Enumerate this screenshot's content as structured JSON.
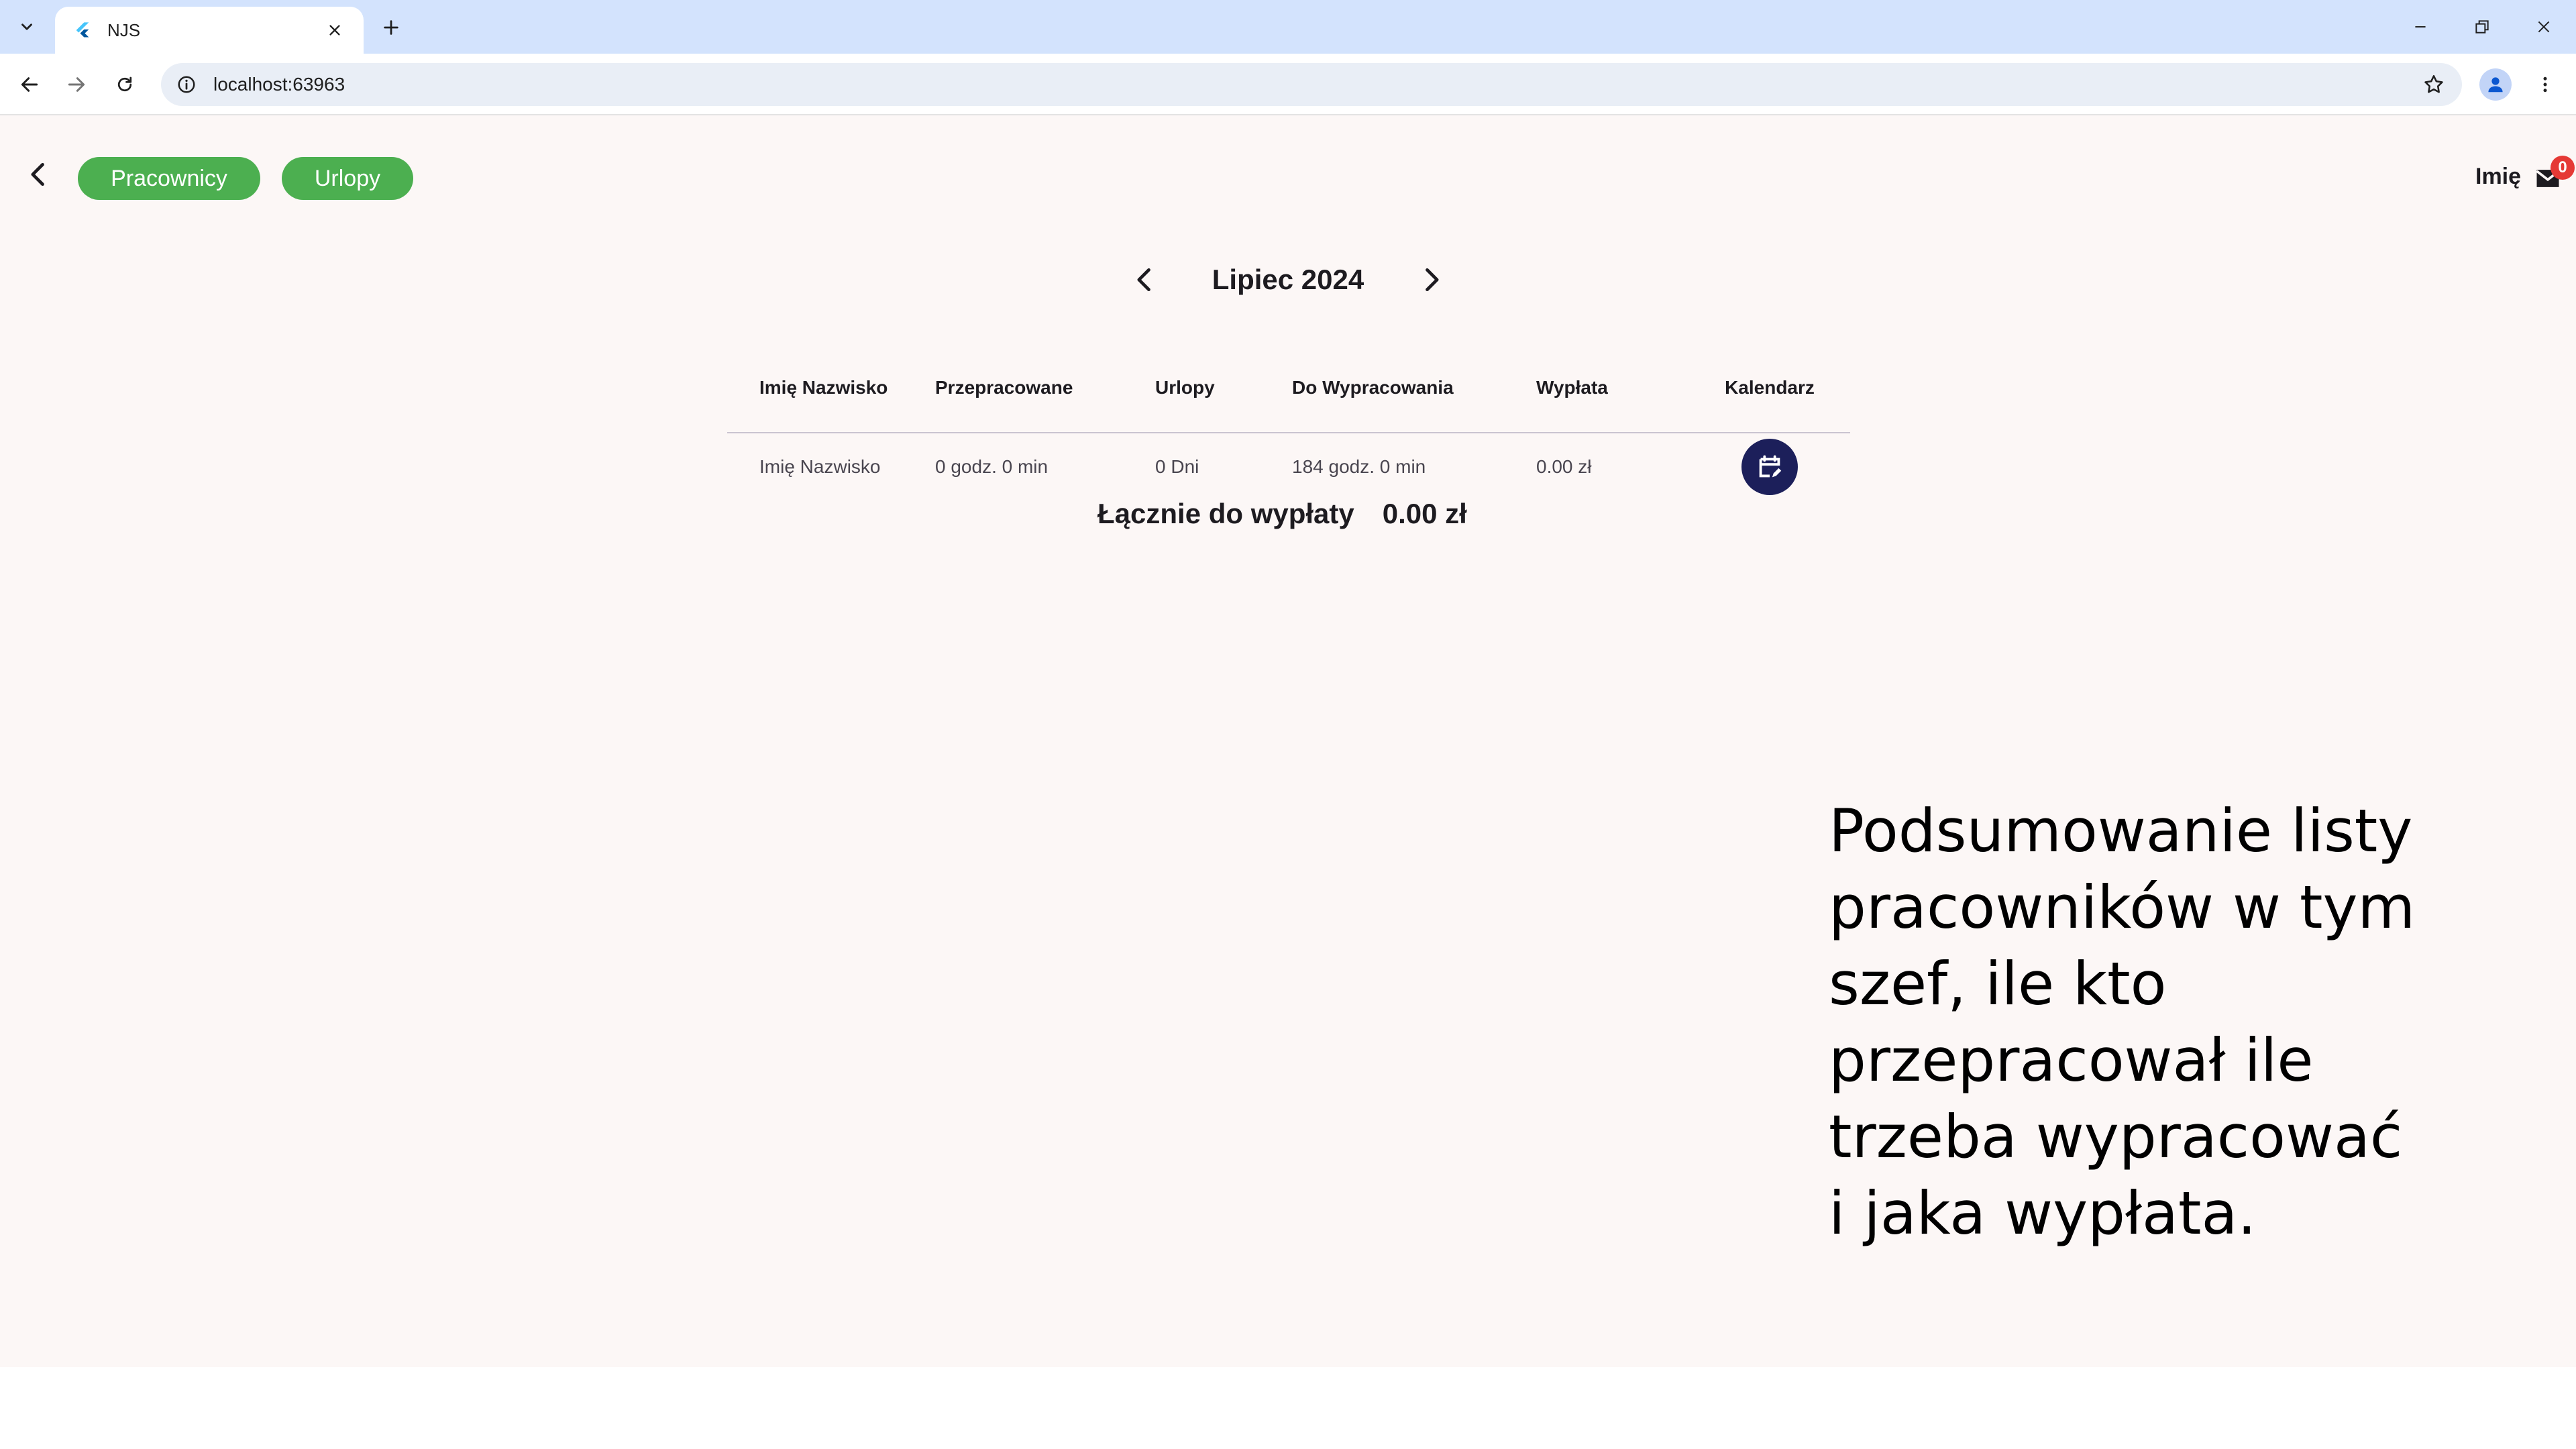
{
  "browser": {
    "tab_title": "NJS",
    "url": "localhost:63963",
    "icons": {
      "tab_dropdown": "chevron-down-icon",
      "favicon": "flutter-icon",
      "tab_close": "close-icon",
      "new_tab": "plus-icon",
      "minimize": "minimize-icon",
      "restore": "restore-icon",
      "close_window": "close-icon",
      "back": "arrow-left-icon",
      "forward": "arrow-right-icon",
      "reload": "reload-icon",
      "site_info": "info-icon",
      "bookmark": "star-icon",
      "profile": "person-icon",
      "menu": "more-vert-icon"
    }
  },
  "header": {
    "buttons": [
      {
        "label": "Pracownicy"
      },
      {
        "label": "Urlopy"
      }
    ],
    "user_name": "Imię",
    "mail_badge_count": "0",
    "colors": {
      "pill": "#4caf50",
      "badge": "#e53935"
    }
  },
  "period": {
    "label": "Lipiec 2024"
  },
  "table": {
    "columns": [
      "Imię Nazwisko",
      "Przepracowane",
      "Urlopy",
      "Do Wypracowania",
      "Wypłata",
      "Kalendarz"
    ],
    "rows": [
      {
        "name": "Imię Nazwisko",
        "worked": "0 godz. 0 min",
        "leave": "0 Dni",
        "to_work": "184 godz. 0 min",
        "pay": "0.00 zł",
        "calendar_icon": "edit-calendar-icon"
      }
    ]
  },
  "summary": {
    "label": "Łącznie do wypłaty",
    "value": "0.00 zł"
  },
  "annotation": {
    "text": "Podsumowanie listy pracowników w tym szef, ile kto przepracował ile trzeba wypracować i jaka wypłata."
  }
}
